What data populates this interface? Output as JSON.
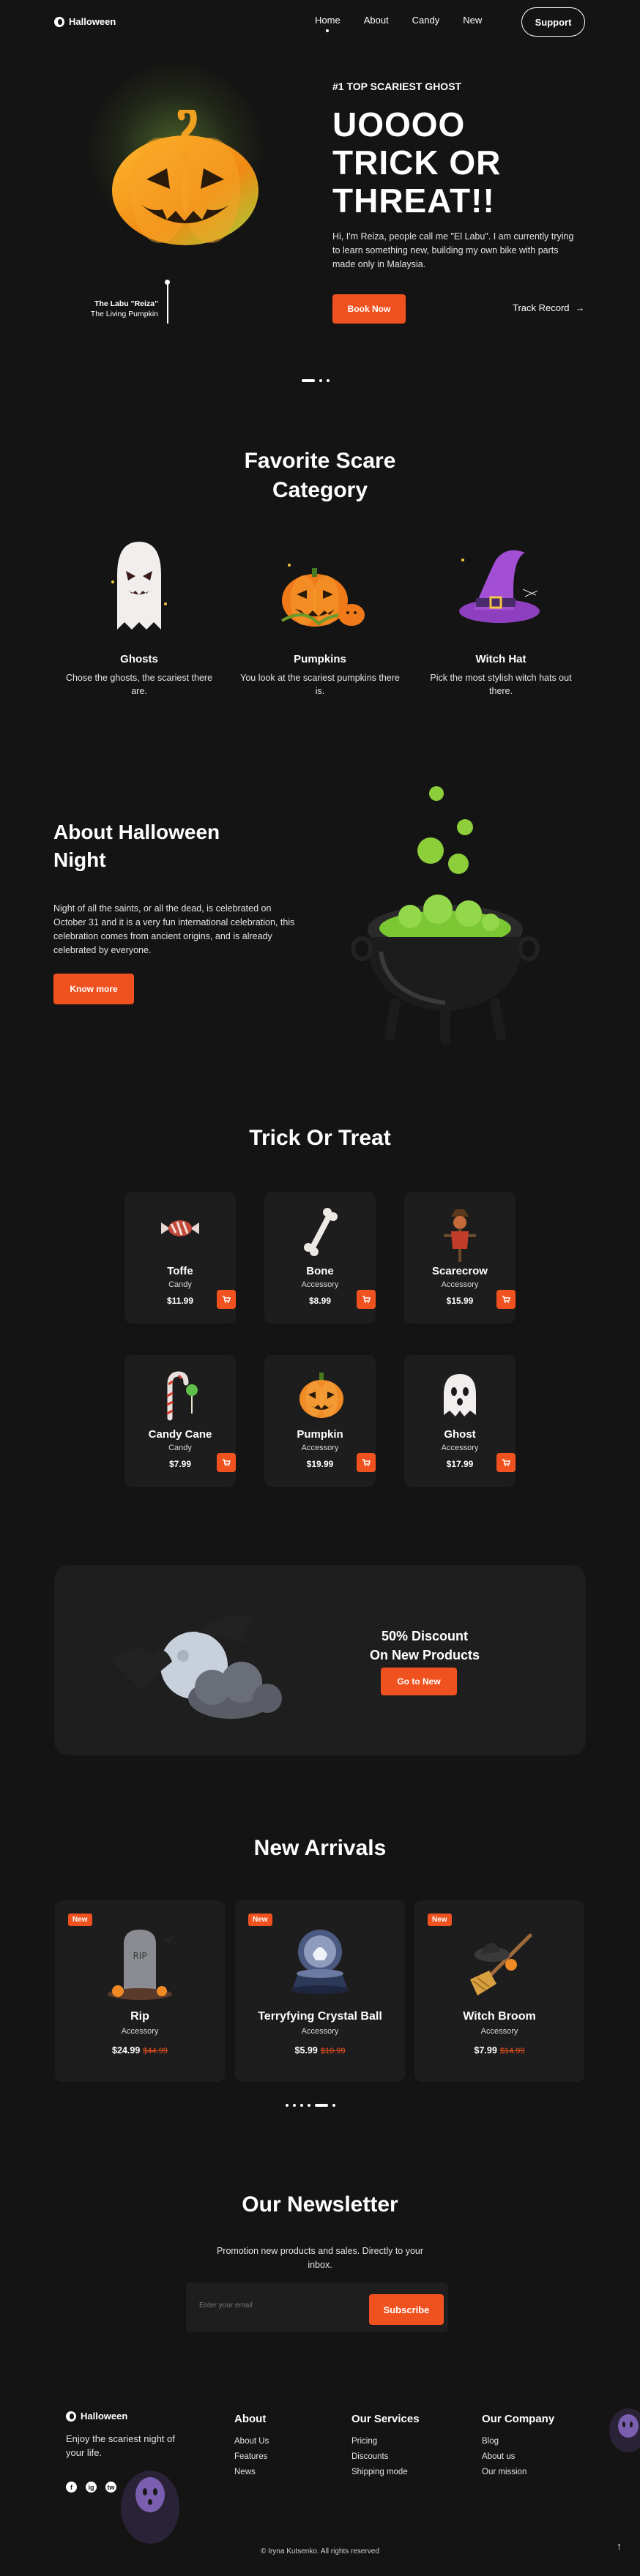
{
  "header": {
    "logo": "Halloween",
    "nav": [
      "Home",
      "About",
      "Candy",
      "New"
    ],
    "support": "Support"
  },
  "hero": {
    "subtitle": "#1 TOP SCARIEST GHOST",
    "title_line1": "UOOOO",
    "title_line2": "TRICK OR",
    "title_line3": "THREAT!!",
    "description": "Hi, I'm Reiza, people call me \"El Labu\". I am currently trying to learn something new, building my own bike with parts made only in Malaysia.",
    "book_now": "Book Now",
    "track_record": "Track Record",
    "caption_name": "The Labu \"Reiza\"",
    "caption_sub": "The Living Pumpkin"
  },
  "categories": {
    "title_line1": "Favorite Scare",
    "title_line2": "Category",
    "items": [
      {
        "name": "Ghosts",
        "desc": "Chose the ghosts, the scariest there are."
      },
      {
        "name": "Pumpkins",
        "desc": "You look at the scariest pumpkins there is."
      },
      {
        "name": "Witch Hat",
        "desc": "Pick the most stylish witch hats out there."
      }
    ]
  },
  "about": {
    "title": "About Halloween Night",
    "description": "Night of all the saints, or all the dead, is celebrated on October 31 and it is a very fun international celebration, this celebration comes from ancient origins, and is already celebrated by everyone.",
    "button": "Know more"
  },
  "products": {
    "title": "Trick Or Treat",
    "items": [
      {
        "name": "Toffe",
        "type": "Candy",
        "price": "$11.99",
        "icon": "candy-icon"
      },
      {
        "name": "Bone",
        "type": "Accessory",
        "price": "$8.99",
        "icon": "bone-icon"
      },
      {
        "name": "Scarecrow",
        "type": "Accessory",
        "price": "$15.99",
        "icon": "scarecrow-icon"
      },
      {
        "name": "Candy Cane",
        "type": "Candy",
        "price": "$7.99",
        "icon": "candy-cane-icon"
      },
      {
        "name": "Pumpkin",
        "type": "Accessory",
        "price": "$19.99",
        "icon": "pumpkin-icon"
      },
      {
        "name": "Ghost",
        "type": "Accessory",
        "price": "$17.99",
        "icon": "ghost-icon"
      }
    ]
  },
  "discount": {
    "line1": "50% Discount",
    "line2": "On New Products",
    "button": "Go to New"
  },
  "arrivals": {
    "title": "New Arrivals",
    "items": [
      {
        "badge": "New",
        "name": "Rip",
        "type": "Accessory",
        "price": "$24.99",
        "old_price": "$44.99"
      },
      {
        "badge": "New",
        "name": "Terryfying Crystal Ball",
        "type": "Accessory",
        "price": "$5.99",
        "old_price": "$10.99"
      },
      {
        "badge": "New",
        "name": "Witch Broom",
        "type": "Accessory",
        "price": "$7.99",
        "old_price": "$14.99"
      }
    ]
  },
  "newsletter": {
    "title": "Our Newsletter",
    "description": "Promotion new products and sales. Directly to your inbox.",
    "placeholder": "Enter your email",
    "button": "Subscribe"
  },
  "footer": {
    "logo": "Halloween",
    "tagline": "Enjoy the scariest night of your life.",
    "social": [
      "f",
      "ig",
      "tw"
    ],
    "columns": [
      {
        "title": "About",
        "links": [
          "About Us",
          "Features",
          "News"
        ]
      },
      {
        "title": "Our Services",
        "links": [
          "Pricing",
          "Discounts",
          "Shipping mode"
        ]
      },
      {
        "title": "Our Company",
        "links": [
          "Blog",
          "About us",
          "Our mission"
        ]
      }
    ],
    "copyright": "© Iryna Kutsenko. All rights reserved"
  },
  "colors": {
    "accent": "#f0521f",
    "background": "#151414",
    "card": "#1e1d1d"
  }
}
